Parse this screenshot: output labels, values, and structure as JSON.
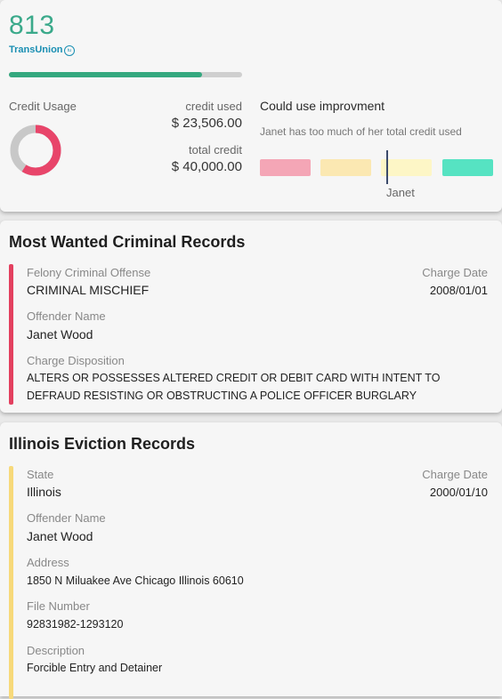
{
  "credit": {
    "score": "813",
    "bureau": "TransUnion",
    "bureau_badge": "tu",
    "score_progress_fraction": 0.83,
    "usage_label": "Credit Usage",
    "usage_fraction": 0.59,
    "credit_used_label": "credit used",
    "credit_used_value": "$ 23,506.00",
    "total_credit_label": "total credit",
    "total_credit_value": "$ 40,000.00",
    "status_title": "Could use improvment",
    "status_description": "Janet has too much of her total credit used",
    "marker_label": "Janet",
    "colors": {
      "score": "#3aa98a",
      "progress": "#34a87f",
      "donut_used": "#e8456a",
      "donut_rest": "#c8c8c8",
      "segments": [
        "#f4a6b6",
        "#fbe8b2",
        "#fdf6c6",
        "#56e3c2"
      ]
    }
  },
  "criminal": {
    "title": "Most Wanted Criminal Records",
    "accent_color": "#e3405f",
    "offense_label": "Felony Criminal Offense",
    "offense_value": "CRIMINAL MISCHIEF",
    "charge_date_label": "Charge Date",
    "charge_date_value": "2008/01/01",
    "offender_label": "Offender Name",
    "offender_value": "Janet Wood",
    "disposition_label": "Charge Disposition",
    "disposition_line1": "ALTERS OR POSSESSES ALTERED CREDIT OR DEBIT CARD WITH INTENT TO",
    "disposition_line2": "DEFRAUD RESISTING OR OBSTRUCTING A POLICE OFFICER BURGLARY"
  },
  "eviction": {
    "title": "Illinois Eviction Records",
    "accent_color": "#f7d97a",
    "state_label": "State",
    "state_value": "Illinois",
    "charge_date_label": "Charge Date",
    "charge_date_value": "2000/01/10",
    "offender_label": "Offender Name",
    "offender_value": "Janet Wood",
    "address_label": "Address",
    "address_value": "1850 N Miluakee Ave Chicago Illinois 60610",
    "file_number_label": "File Number",
    "file_number_value": "92831982-1293120",
    "description_label": "Description",
    "description_value": "Forcible Entry and Detainer"
  }
}
